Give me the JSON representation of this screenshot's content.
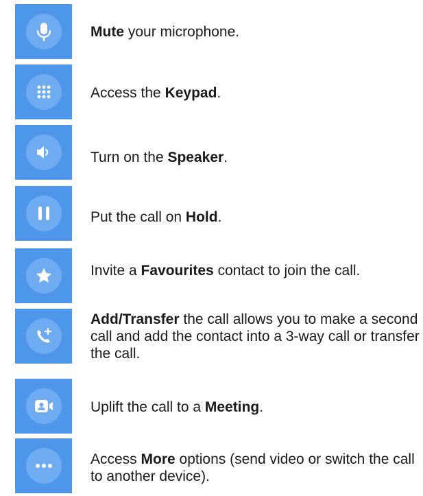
{
  "rows": [
    {
      "icon": "microphone-icon",
      "pre": "",
      "bold": "Mute",
      "post": " your microphone."
    },
    {
      "icon": "keypad-icon",
      "pre": "Access the ",
      "bold": "Keypad",
      "post": "."
    },
    {
      "icon": "speaker-icon",
      "pre": "Turn on the ",
      "bold": "Speaker",
      "post": "."
    },
    {
      "icon": "pause-icon",
      "pre": "Put the call on ",
      "bold": "Hold",
      "post": "."
    },
    {
      "icon": "star-icon",
      "pre": "Invite a ",
      "bold": "Favourites",
      "post": " contact to join the call."
    },
    {
      "icon": "add-call-icon",
      "pre": "",
      "bold": "Add/Transfer",
      "post": " the call allows you to make a second call and add the contact into a 3-way call or transfer the call."
    },
    {
      "icon": "meeting-icon",
      "pre": "Uplift the call to a ",
      "bold": "Meeting",
      "post": "."
    },
    {
      "icon": "more-icon",
      "pre": "Access ",
      "bold": "More",
      "post": " options (send video or switch the call to another device)."
    }
  ],
  "colors": {
    "tile": "#4d96ea",
    "circle": "#6fabf1",
    "glyph": "#ffffff"
  }
}
